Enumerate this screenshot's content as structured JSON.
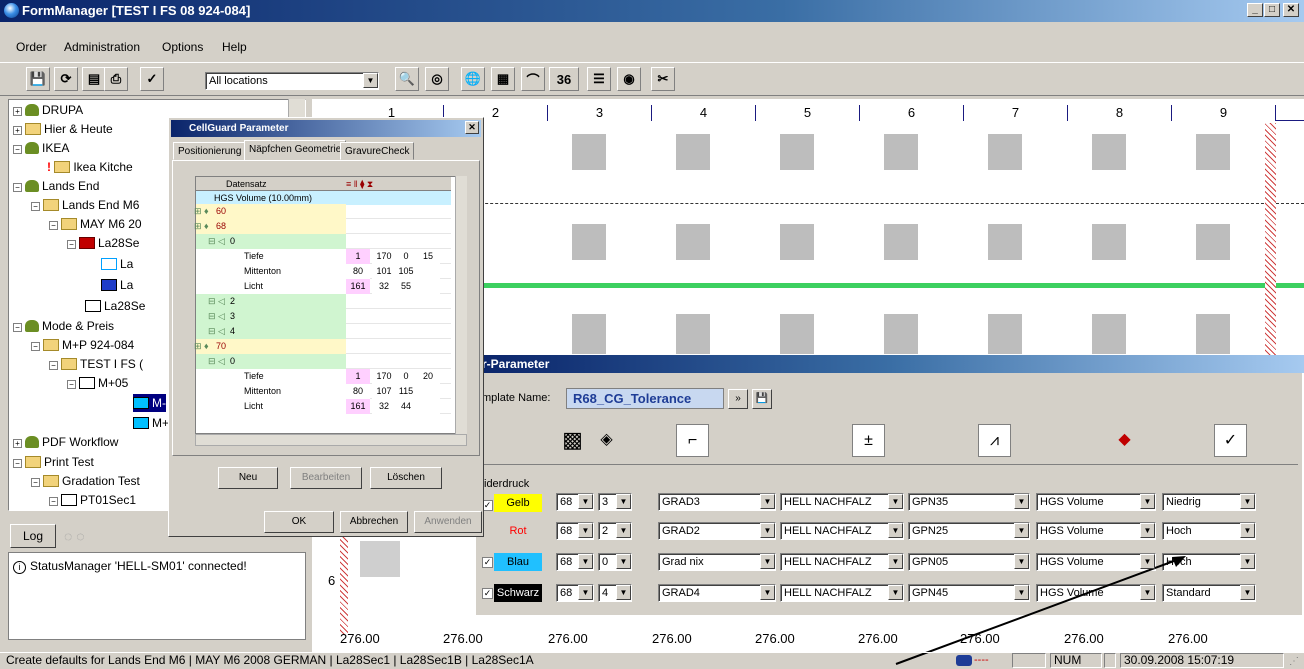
{
  "window": {
    "title": "FormManager  [TEST I FS 08 924-084]",
    "btn_min": "_",
    "btn_max": "□",
    "btn_close": "✕"
  },
  "menu": [
    "Order",
    "Administration",
    "Options",
    "Help"
  ],
  "toolbar": {
    "location_value": "All locations",
    "count_label": "36"
  },
  "tree": [
    {
      "label": "DRUPA"
    },
    {
      "label": "Hier & Heute"
    },
    {
      "label": "IKEA"
    },
    {
      "label": "Ikea Kitche"
    },
    {
      "label": "Lands End"
    },
    {
      "label": "Lands End M6"
    },
    {
      "label": "MAY M6 20"
    },
    {
      "label": "La28Se"
    },
    {
      "label": "La"
    },
    {
      "label": "La"
    },
    {
      "label": "La28Se"
    },
    {
      "label": "Mode & Preis"
    },
    {
      "label": "M+P 924-084"
    },
    {
      "label": "TEST I FS ("
    },
    {
      "label": "M+05"
    },
    {
      "label": "M-"
    },
    {
      "label": "M+"
    },
    {
      "label": "PDF Workflow"
    },
    {
      "label": "Print Test"
    },
    {
      "label": "Gradation Test"
    },
    {
      "label": "PT01Sec1"
    }
  ],
  "log": {
    "button": "Log",
    "message": "StatusManager 'HELL-SM01' connected!"
  },
  "grid": {
    "columns": [
      "1",
      "2",
      "3",
      "4",
      "5",
      "6",
      "7",
      "8",
      "9"
    ],
    "footer": [
      "276.00",
      "276.00",
      "276.00",
      "276.00",
      "276.00",
      "276.00",
      "276.00",
      "276.00",
      "276.00"
    ],
    "row_label": "6"
  },
  "dialog": {
    "title": "CellGuard Parameter",
    "tabs": [
      "Positionierung",
      "Näpfchen Geometrie",
      "GravureCheck"
    ],
    "table_header": "Datensatz",
    "root": "HGS Volume (10.00mm)",
    "rows": [
      {
        "label": "60",
        "indent": 1,
        "kind": "diamond"
      },
      {
        "label": "68",
        "indent": 1,
        "kind": "diamond"
      },
      {
        "label": "0",
        "indent": 2,
        "kind": "tri"
      },
      {
        "label": "Tiefe",
        "indent": 3,
        "vals": [
          "1",
          "170",
          "0",
          "15"
        ]
      },
      {
        "label": "Mittenton",
        "indent": 3,
        "vals": [
          "80",
          "101",
          "105",
          ""
        ]
      },
      {
        "label": "Licht",
        "indent": 3,
        "vals": [
          "161",
          "32",
          "55",
          ""
        ]
      },
      {
        "label": "2",
        "indent": 2,
        "kind": "tri"
      },
      {
        "label": "3",
        "indent": 2,
        "kind": "tri"
      },
      {
        "label": "4",
        "indent": 2,
        "kind": "tri"
      },
      {
        "label": "70",
        "indent": 1,
        "kind": "diamond"
      },
      {
        "label": "0",
        "indent": 2,
        "kind": "tri"
      },
      {
        "label": "Tiefe",
        "indent": 3,
        "vals": [
          "1",
          "170",
          "0",
          "20"
        ]
      },
      {
        "label": "Mittenton",
        "indent": 3,
        "vals": [
          "80",
          "107",
          "115",
          ""
        ]
      },
      {
        "label": "Licht",
        "indent": 3,
        "vals": [
          "161",
          "32",
          "44",
          ""
        ]
      }
    ],
    "btn_new": "Neu",
    "btn_edit": "Bearbeiten",
    "btn_delete": "Löschen",
    "btn_ok": "OK",
    "btn_cancel": "Abbrechen",
    "btn_apply": "Anwenden"
  },
  "param": {
    "title": "r-Parameter",
    "template_label": "mplate Name:",
    "template_value": "R68_CG_Tolerance",
    "wider_label": "iderdruck",
    "rows": [
      {
        "name": "Gelb",
        "color": "#ffff00",
        "text": "#000000",
        "checked": "✓",
        "a": "68",
        "b": "3",
        "grad": "GRAD3",
        "hell": "HELL NACHFALZ",
        "gpn": "GPN35",
        "hgs": "HGS Volume",
        "level": "Niedrig"
      },
      {
        "name": "Rot",
        "color": "#ff0000",
        "text": "#ff0000",
        "checked": "✓",
        "a": "68",
        "b": "2",
        "grad": "GRAD2",
        "hell": "HELL NACHFALZ",
        "gpn": "GPN25",
        "hgs": "HGS Volume",
        "level": "Hoch"
      },
      {
        "name": "Blau",
        "color": "#20c0ff",
        "text": "#000000",
        "checked": "✓",
        "a": "68",
        "b": "0",
        "grad": "Grad nix",
        "hell": "HELL NACHFALZ",
        "gpn": "GPN05",
        "hgs": "HGS Volume",
        "level": "Hoch"
      },
      {
        "name": "Schwarz",
        "color": "#000000",
        "text": "#ffffff",
        "checked": "✓",
        "a": "68",
        "b": "4",
        "grad": "GRAD4",
        "hell": "HELL NACHFALZ",
        "gpn": "GPN45",
        "hgs": "HGS Volume",
        "level": "Standard"
      }
    ]
  },
  "status": {
    "text": "Create defaults for Lands End M6 | MAY M6 2008 GERMAN | La28Sec1 | La28Sec1B | La28Sec1A",
    "num": "NUM",
    "datetime": "30.09.2008  15:07:19"
  }
}
